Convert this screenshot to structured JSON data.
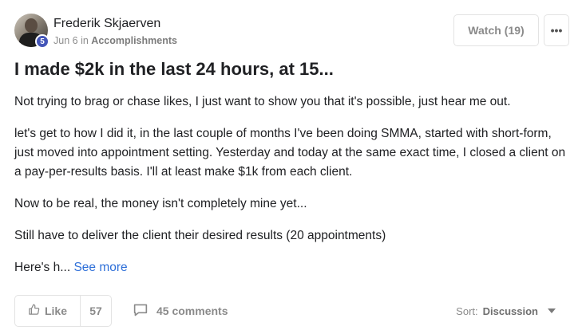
{
  "post": {
    "author": "Frederik Skjaerven",
    "level": "5",
    "date": "Jun 6",
    "in_label": "in",
    "category": "Accomplishments",
    "watch_label": "Watch",
    "watch_count": "(19)",
    "more_label": "•••",
    "title": "I made $2k in the last 24 hours, at 15...",
    "paragraphs": [
      "Not trying to brag or chase likes, I just want to show you that it's possible, just hear me out.",
      "let's get to how I did it, in the last couple of months I've been doing SMMA, started with short-form, just moved into appointment setting. Yesterday and today at the same exact time, I closed a client on a pay-per-results basis. I'll at least make $1k from each client.",
      "Now to be real, the money isn't completely mine yet...",
      "Still have to deliver the client their desired results (20 appointments)"
    ],
    "truncated_text": "Here's h...",
    "see_more": "See more"
  },
  "footer": {
    "like_label": "Like",
    "like_count": "57",
    "comments_label": "45 comments",
    "sort_label": "Sort:",
    "sort_value": "Discussion"
  },
  "icons": {
    "like": "thumbs-up-icon",
    "comments": "comment-bubble-icon",
    "sort": "caret-down-icon"
  },
  "colors": {
    "level_badge": "#4456b8",
    "link": "#2e6fd8"
  }
}
